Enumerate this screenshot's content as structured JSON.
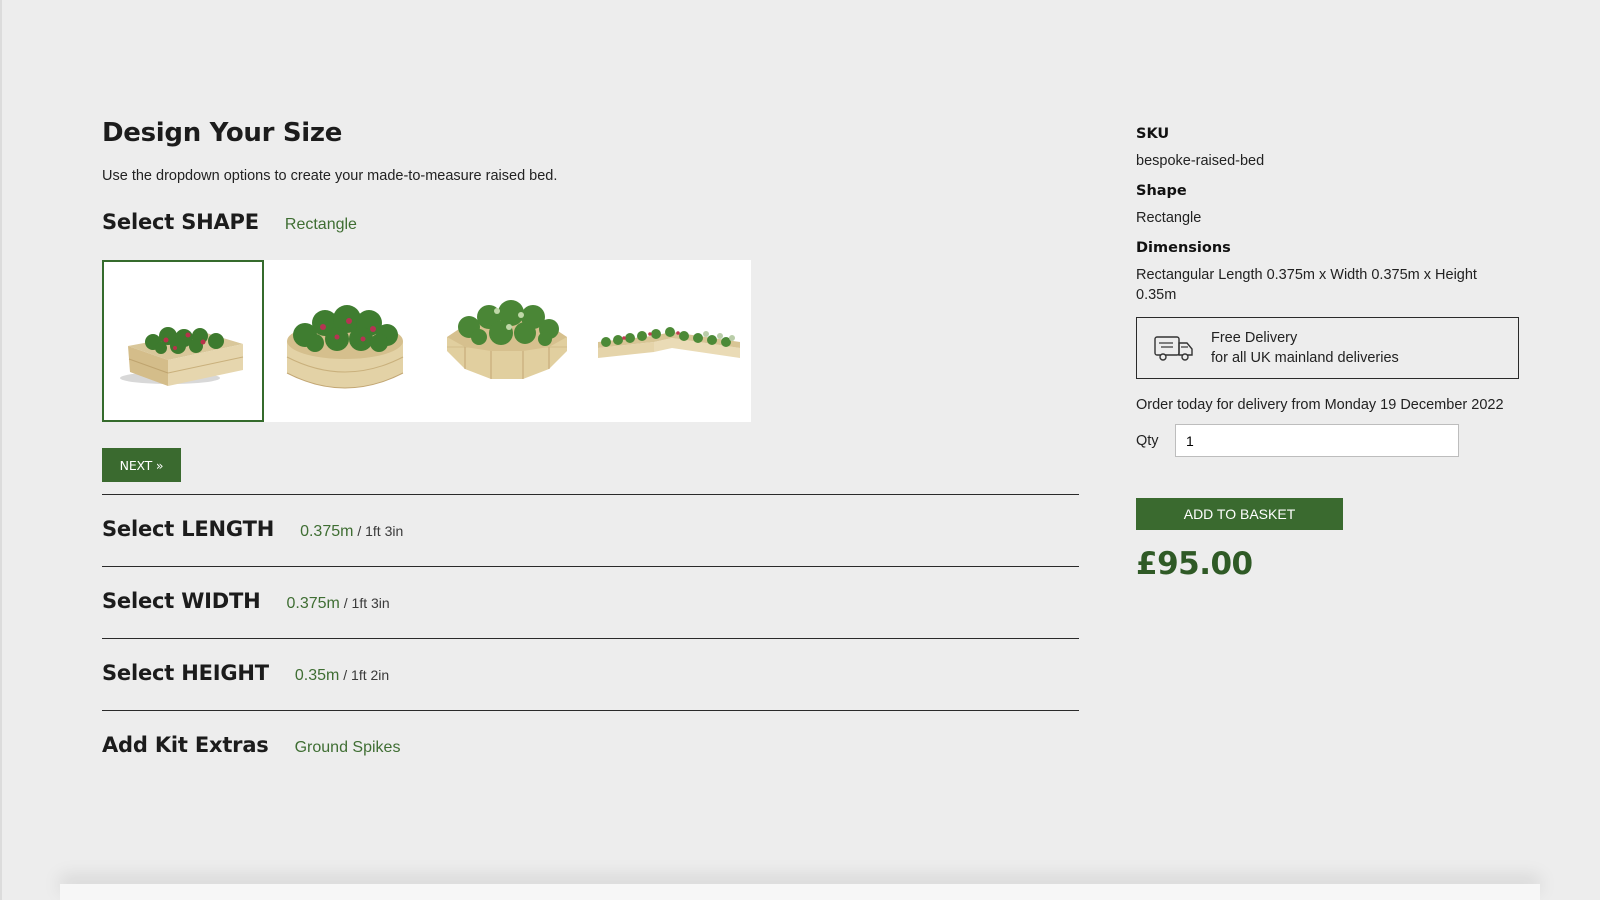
{
  "design": {
    "title": "Design Your Size",
    "intro": "Use the dropdown options to create your made-to-measure raised bed."
  },
  "shape": {
    "title": "Select SHAPE",
    "selected": "Rectangle",
    "options": [
      "Rectangle",
      "Round",
      "Octagonal",
      "L-shape"
    ],
    "next_label": "NEXT »"
  },
  "sections": [
    {
      "title": "Select LENGTH",
      "value": "0.375m",
      "alt": " / 1ft 3in"
    },
    {
      "title": "Select WIDTH",
      "value": "0.375m",
      "alt": " / 1ft 3in"
    },
    {
      "title": "Select HEIGHT",
      "value": "0.35m",
      "alt": " / 1ft 2in"
    },
    {
      "title": "Add Kit Extras",
      "value": "Ground Spikes",
      "alt": ""
    }
  ],
  "summary": {
    "sku_label": "SKU",
    "sku": "bespoke-raised-bed",
    "shape_label": "Shape",
    "shape": "Rectangle",
    "dimensions_label": "Dimensions",
    "dimensions": "Rectangular Length 0.375m x Width 0.375m x Height 0.35m"
  },
  "delivery": {
    "line1": "Free Delivery",
    "line2": "for all UK mainland deliveries",
    "icon": "truck-icon"
  },
  "order_note": "Order today for delivery from Monday 19 December 2022",
  "qty": {
    "label": "Qty",
    "value": "1"
  },
  "basket_label": "ADD TO BASKET",
  "price": "£95.00",
  "colors": {
    "brand_green": "#3a6a2f",
    "value_green": "#3f6e33",
    "background": "#ededed"
  }
}
